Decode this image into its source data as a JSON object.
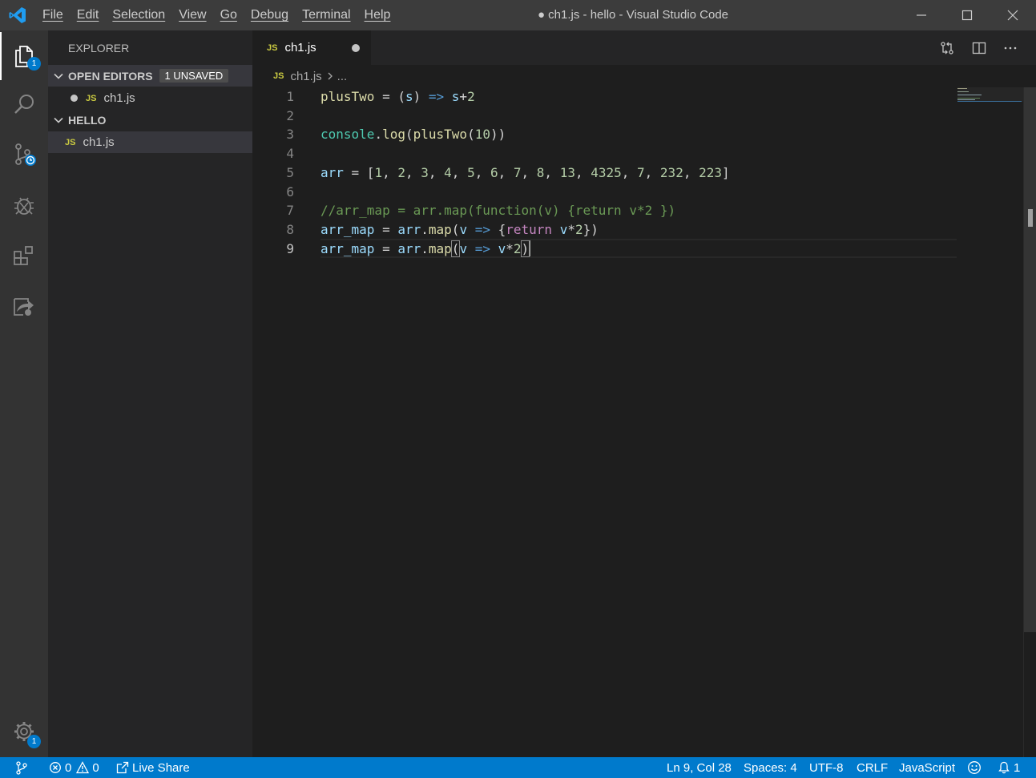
{
  "window": {
    "title": "● ch1.js - hello - Visual Studio Code",
    "menu": [
      "File",
      "Edit",
      "Selection",
      "View",
      "Go",
      "Debug",
      "Terminal",
      "Help"
    ]
  },
  "activity_bar": {
    "items": [
      {
        "name": "explorer",
        "badge": "1"
      },
      {
        "name": "search"
      },
      {
        "name": "source-control"
      },
      {
        "name": "debug"
      },
      {
        "name": "extensions"
      },
      {
        "name": "live-share"
      }
    ],
    "settings_badge": "1"
  },
  "sidebar": {
    "title": "EXPLORER",
    "open_editors": {
      "label": "OPEN EDITORS",
      "badge": "1 UNSAVED",
      "files": [
        {
          "icon": "JS",
          "name": "ch1.js",
          "dirty": true
        }
      ]
    },
    "folder": {
      "label": "HELLO",
      "files": [
        {
          "icon": "JS",
          "name": "ch1.js"
        }
      ]
    }
  },
  "tabs": [
    {
      "icon": "JS",
      "label": "ch1.js",
      "dirty": true
    }
  ],
  "breadcrumb": {
    "icon": "JS",
    "file": "ch1.js",
    "rest": "..."
  },
  "editor": {
    "line_numbers": [
      "1",
      "2",
      "3",
      "4",
      "5",
      "6",
      "7",
      "8",
      "9"
    ],
    "current_line": "9",
    "lines": [
      "plusTwo = (s) => s+2",
      "",
      "console.log(plusTwo(10))",
      "",
      "arr = [1, 2, 3, 4, 5, 6, 7, 8, 13, 4325, 7, 232, 223]",
      "",
      "//arr_map = arr.map(function(v) {return v*2 })",
      "arr_map = arr.map(v => {return v*2})",
      "arr_map = arr.map(v => v*2)"
    ]
  },
  "statusbar": {
    "errors": "0",
    "warnings": "0",
    "live_share": "Live Share",
    "position": "Ln 9, Col 28",
    "spaces": "Spaces: 4",
    "encoding": "UTF-8",
    "eol": "CRLF",
    "language": "JavaScript",
    "notifications": "1"
  },
  "colors": {
    "accent": "#007acc",
    "activity_bar": "#333333",
    "sidebar": "#252526",
    "editor": "#1e1e1e",
    "titlebar": "#3c3c3c",
    "js_icon": "#cbcb41"
  }
}
